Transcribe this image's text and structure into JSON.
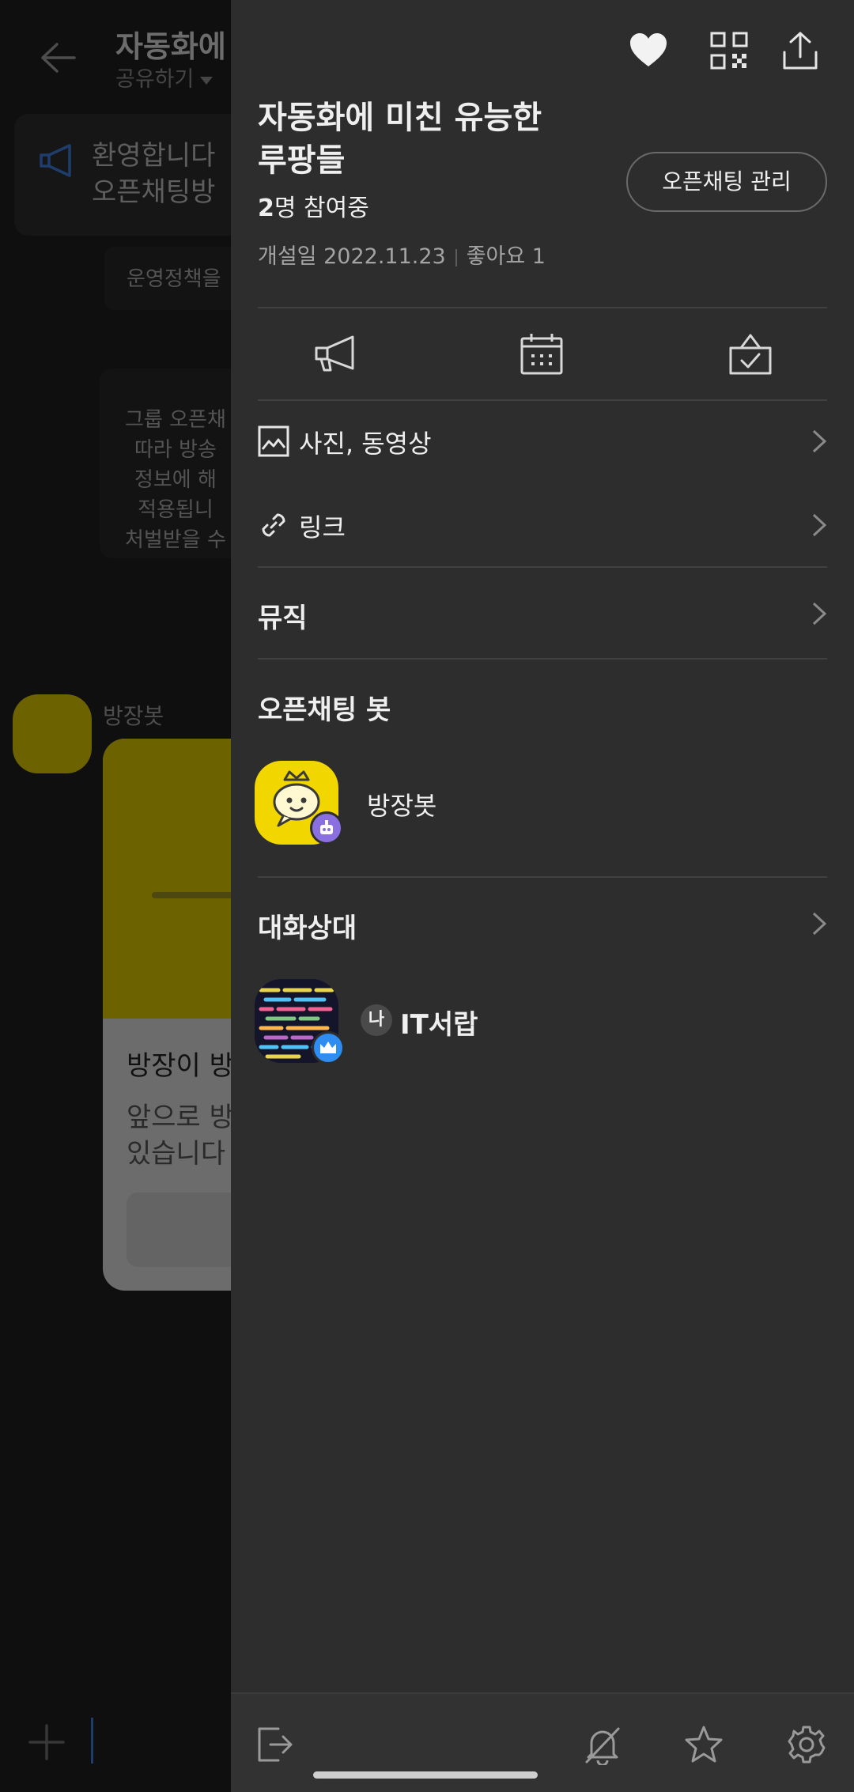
{
  "background_chat": {
    "title": "자동화에",
    "share_label": "공유하기",
    "notice_text": "환영합니다\n오픈채팅방",
    "policy_text": "운영정책을",
    "rules_text": "그룹 오픈채\n따라 방송\n정보에 해\n적용됩니\n처벌받을 수",
    "bot_name": "방장봇",
    "card_title": "방장이 방",
    "card_body": "앞으로 방\n있습니다"
  },
  "drawer": {
    "room_title": "자동화에 미친 유능한\n루팡들",
    "member_count": "2",
    "member_suffix": "명 참여중",
    "manage_button": "오픈채팅 관리",
    "created_label": "개설일 2022.11.23",
    "likes_label": "좋아요 1",
    "menu": {
      "photos_label": "사진, 동영상",
      "links_label": "링크",
      "music_label": "뮤직"
    },
    "bot_section_title": "오픈채팅 봇",
    "bot_name": "방장봇",
    "members_section_title": "대화상대",
    "me_badge": "나",
    "member_name": "IT서랍"
  },
  "icons": {
    "heart": "heart-icon",
    "qr": "qr-code-icon",
    "share": "share-icon",
    "notice": "megaphone-icon",
    "calendar": "calendar-icon",
    "vote": "vote-icon",
    "photo": "photo-icon",
    "link": "link-icon",
    "chevron": "chevron-right-icon",
    "leave": "exit-icon",
    "mute": "bell-off-icon",
    "favorite": "star-icon",
    "settings": "gear-icon"
  },
  "colors": {
    "drawer_bg": "#2d2d2d",
    "bot_yellow": "#f2d600",
    "bot_badge": "#8a6fe0",
    "host_badge": "#2f8cf0",
    "accent_blue": "#3d7bd9"
  }
}
